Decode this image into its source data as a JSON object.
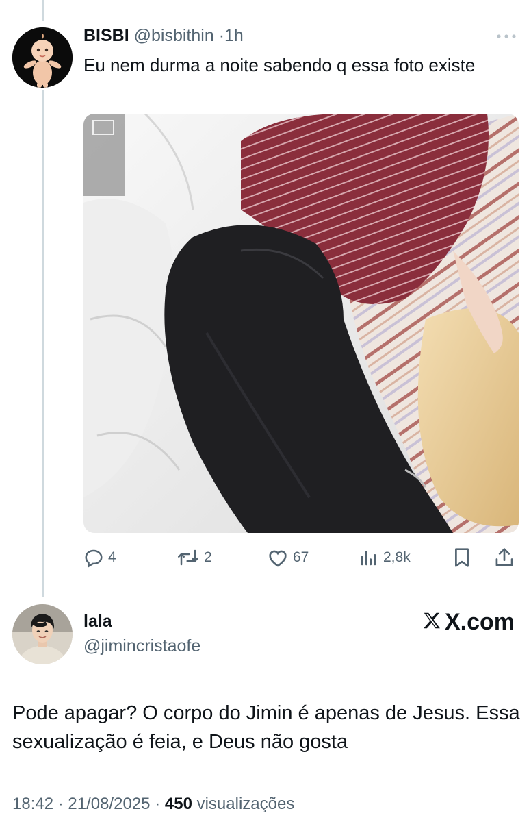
{
  "quoted_tweet": {
    "author_name": "BISBI",
    "handle": "@bisbithin",
    "separator": "·",
    "time": "1h",
    "text": "Eu nem durma a noite sabendo q essa foto existe",
    "actions": {
      "replies": "4",
      "reposts": "2",
      "likes": "67",
      "views": "2,8k"
    }
  },
  "reply": {
    "author_name": "lala",
    "handle": "@jimincristaofe",
    "brand": "X.com",
    "text": "Pode apagar? O corpo do Jimin é apenas de Jesus. Essa sexualização é feia, e Deus não gosta",
    "time": "18:42",
    "date": "21/08/2025",
    "separator": "·",
    "view_count": "450",
    "view_label": "visualizações"
  },
  "colors": {
    "text_primary": "#0f1419",
    "text_secondary": "#536471",
    "thread_line": "#cfd9de",
    "shirt": "#8a2e3c",
    "jeans": "#1f1f22"
  },
  "icons": [
    "more-icon",
    "reply-icon",
    "repost-icon",
    "like-icon",
    "views-icon",
    "bookmark-icon",
    "share-icon",
    "x-logo-icon"
  ]
}
